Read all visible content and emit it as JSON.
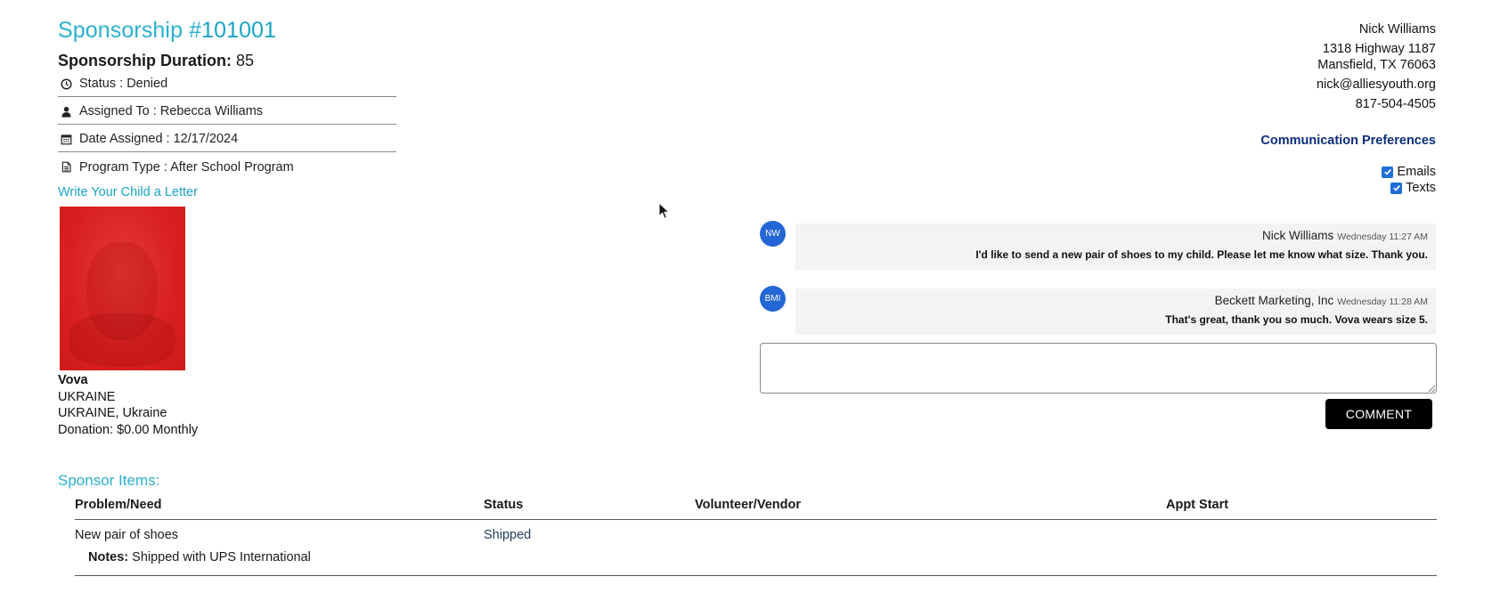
{
  "header": {
    "title_prefix": "Sponsorship #",
    "title_number": "101001",
    "duration_label": "Sponsorship Duration:",
    "duration_value": "85"
  },
  "info": {
    "status": "Status : Denied",
    "assigned_to": "Assigned To : Rebecca Williams",
    "date_assigned": "Date Assigned : 12/17/2024",
    "program_type": "Program Type : After School Program"
  },
  "letter_link": "Write Your Child a Letter",
  "child": {
    "name": "Vova",
    "country": "UKRAINE",
    "location": "UKRAINE, Ukraine",
    "donation": "Donation: $0.00 Monthly"
  },
  "contact": {
    "name": "Nick Williams",
    "address1": "1318 Highway 1187",
    "address2": "Mansfield, TX 76063",
    "email": "nick@alliesyouth.org",
    "phone": "817-504-4505"
  },
  "communication": {
    "title": "Communication Preferences",
    "emails_label": "Emails",
    "texts_label": "Texts"
  },
  "comments": [
    {
      "initials": "NW",
      "author": "Nick Williams",
      "time": "Wednesday 11:27 AM",
      "message": "I'd like to send a new pair of shoes to my child. Please let me know what size. Thank you."
    },
    {
      "initials": "BMI",
      "author": "Beckett Marketing, Inc",
      "time": "Wednesday 11:28 AM",
      "message": "That's great, thank you so much. Vova wears size 5."
    }
  ],
  "comment_input": {
    "value": "",
    "placeholder": ""
  },
  "comment_button": "COMMENT",
  "sponsor_items": {
    "title": "Sponsor Items:",
    "columns": [
      "Problem/Need",
      "Status",
      "Volunteer/Vendor",
      "Appt Start"
    ],
    "rows": [
      {
        "problem": "New pair of shoes",
        "status": "Shipped",
        "volunteer": "",
        "appt_start": "",
        "notes_label": "Notes:",
        "notes": "Shipped with UPS International"
      }
    ]
  },
  "colors": {
    "accent": "#2ab0cf",
    "avatar": "#2466d6",
    "pref_title": "#0d2d7a",
    "button": "#000000"
  },
  "icons": {
    "status": "clock-icon",
    "assigned": "user-icon",
    "date": "calendar-icon",
    "program": "document-icon"
  }
}
